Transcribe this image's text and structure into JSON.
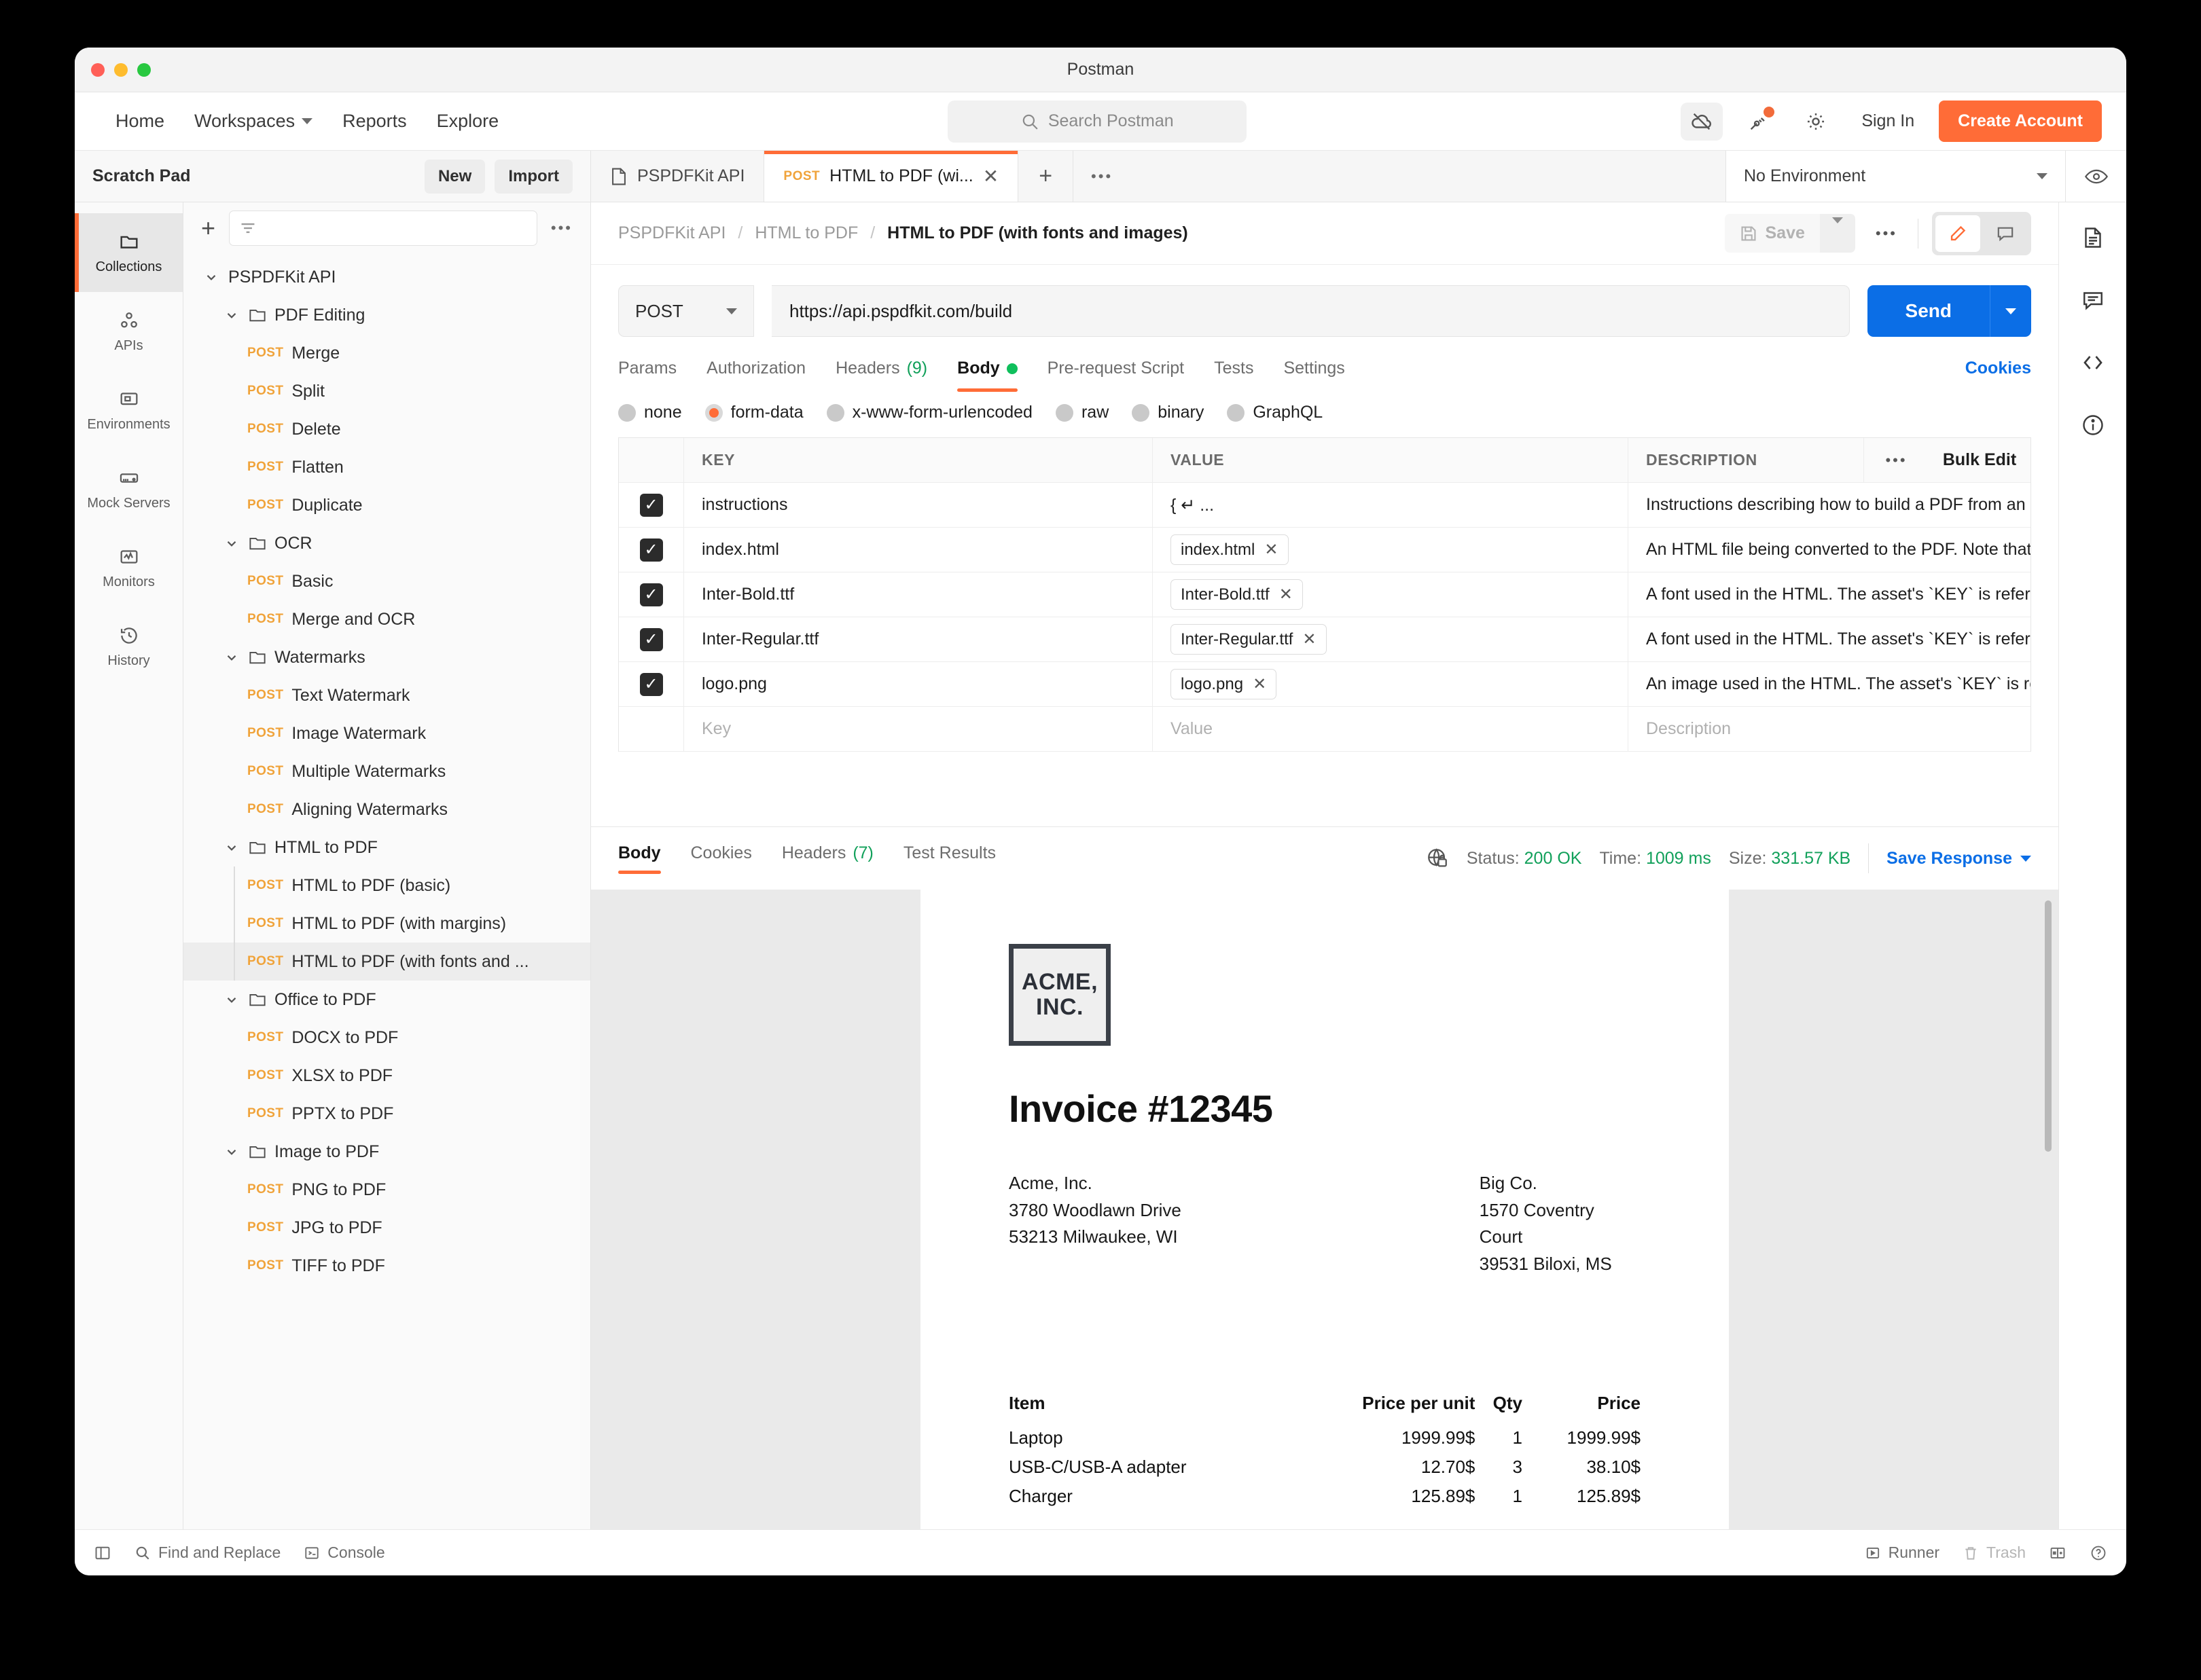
{
  "window": {
    "title": "Postman"
  },
  "topnav": {
    "items": [
      {
        "label": "Home",
        "has_caret": false
      },
      {
        "label": "Workspaces",
        "has_caret": true
      },
      {
        "label": "Reports",
        "has_caret": false
      },
      {
        "label": "Explore",
        "has_caret": false
      }
    ],
    "search_placeholder": "Search Postman",
    "sign_in": "Sign In",
    "create_account": "Create Account"
  },
  "scratchpad": {
    "title": "Scratch Pad",
    "new_label": "New",
    "import_label": "Import"
  },
  "tabs": {
    "items": [
      {
        "method": "",
        "label": "PSPDFKit API",
        "active": false
      },
      {
        "method": "POST",
        "label": "HTML to PDF (wi...",
        "active": true
      }
    ]
  },
  "environment": {
    "selected": "No Environment"
  },
  "rail": {
    "items": [
      {
        "label": "Collections",
        "icon": "collection-icon",
        "active": true
      },
      {
        "label": "APIs",
        "icon": "apis-icon",
        "active": false
      },
      {
        "label": "Environments",
        "icon": "environments-icon",
        "active": false
      },
      {
        "label": "Mock Servers",
        "icon": "mock-servers-icon",
        "active": false
      },
      {
        "label": "Monitors",
        "icon": "monitors-icon",
        "active": false
      },
      {
        "label": "History",
        "icon": "history-icon",
        "active": false
      }
    ]
  },
  "sidebar": {
    "tree": [
      {
        "depth": 0,
        "type": "collection",
        "label": "PSPDFKit API",
        "expanded": true
      },
      {
        "depth": 1,
        "type": "folder",
        "label": "PDF Editing",
        "expanded": true
      },
      {
        "depth": 2,
        "type": "request",
        "method": "POST",
        "label": "Merge"
      },
      {
        "depth": 2,
        "type": "request",
        "method": "POST",
        "label": "Split"
      },
      {
        "depth": 2,
        "type": "request",
        "method": "POST",
        "label": "Delete"
      },
      {
        "depth": 2,
        "type": "request",
        "method": "POST",
        "label": "Flatten"
      },
      {
        "depth": 2,
        "type": "request",
        "method": "POST",
        "label": "Duplicate"
      },
      {
        "depth": 1,
        "type": "folder",
        "label": "OCR",
        "expanded": true
      },
      {
        "depth": 2,
        "type": "request",
        "method": "POST",
        "label": "Basic"
      },
      {
        "depth": 2,
        "type": "request",
        "method": "POST",
        "label": "Merge and OCR"
      },
      {
        "depth": 1,
        "type": "folder",
        "label": "Watermarks",
        "expanded": true
      },
      {
        "depth": 2,
        "type": "request",
        "method": "POST",
        "label": "Text Watermark"
      },
      {
        "depth": 2,
        "type": "request",
        "method": "POST",
        "label": "Image Watermark"
      },
      {
        "depth": 2,
        "type": "request",
        "method": "POST",
        "label": "Multiple Watermarks"
      },
      {
        "depth": 2,
        "type": "request",
        "method": "POST",
        "label": "Aligning Watermarks"
      },
      {
        "depth": 1,
        "type": "folder",
        "label": "HTML to PDF",
        "expanded": true
      },
      {
        "depth": 2,
        "type": "request",
        "method": "POST",
        "label": "HTML to PDF (basic)",
        "guide": true
      },
      {
        "depth": 2,
        "type": "request",
        "method": "POST",
        "label": "HTML to PDF (with margins)",
        "guide": true
      },
      {
        "depth": 2,
        "type": "request",
        "method": "POST",
        "label": "HTML to PDF (with fonts and ...",
        "guide": true,
        "selected": true
      },
      {
        "depth": 1,
        "type": "folder",
        "label": "Office to PDF",
        "expanded": true
      },
      {
        "depth": 2,
        "type": "request",
        "method": "POST",
        "label": "DOCX to PDF"
      },
      {
        "depth": 2,
        "type": "request",
        "method": "POST",
        "label": "XLSX to PDF"
      },
      {
        "depth": 2,
        "type": "request",
        "method": "POST",
        "label": "PPTX to PDF"
      },
      {
        "depth": 1,
        "type": "folder",
        "label": "Image to PDF",
        "expanded": true
      },
      {
        "depth": 2,
        "type": "request",
        "method": "POST",
        "label": "PNG to PDF"
      },
      {
        "depth": 2,
        "type": "request",
        "method": "POST",
        "label": "JPG to PDF"
      },
      {
        "depth": 2,
        "type": "request",
        "method": "POST",
        "label": "TIFF to PDF"
      }
    ]
  },
  "request": {
    "breadcrumb": [
      "PSPDFKit API",
      "HTML to PDF",
      "HTML to PDF (with fonts and images)"
    ],
    "save_label": "Save",
    "method": "POST",
    "url": "https://api.pspdfkit.com/build",
    "send_label": "Send",
    "tabs": [
      {
        "label": "Params",
        "active": false
      },
      {
        "label": "Authorization",
        "active": false
      },
      {
        "label": "Headers",
        "count": "(9)",
        "active": false
      },
      {
        "label": "Body",
        "dot": true,
        "active": true
      },
      {
        "label": "Pre-request Script",
        "active": false
      },
      {
        "label": "Tests",
        "active": false
      },
      {
        "label": "Settings",
        "active": false
      }
    ],
    "cookies_link": "Cookies",
    "body_modes": [
      {
        "label": "none",
        "selected": false
      },
      {
        "label": "form-data",
        "selected": true
      },
      {
        "label": "x-www-form-urlencoded",
        "selected": false
      },
      {
        "label": "raw",
        "selected": false
      },
      {
        "label": "binary",
        "selected": false
      },
      {
        "label": "GraphQL",
        "selected": false
      }
    ],
    "table": {
      "headers": {
        "key": "KEY",
        "value": "VALUE",
        "description": "DESCRIPTION",
        "bulk_edit": "Bulk Edit"
      },
      "rows": [
        {
          "checked": true,
          "key": "instructions",
          "value": "{ ↵ ...",
          "value_is_chip": false,
          "description": "Instructions describing how to build a PDF from an HTML ..."
        },
        {
          "checked": true,
          "key": "index.html",
          "value": "index.html",
          "value_is_chip": true,
          "description": "An HTML file being converted to the PDF. Note that the fil..."
        },
        {
          "checked": true,
          "key": "Inter-Bold.ttf",
          "value": "Inter-Bold.ttf",
          "value_is_chip": true,
          "description": "A font used in the HTML. The asset's `KEY` is referenced ..."
        },
        {
          "checked": true,
          "key": "Inter-Regular.ttf",
          "value": "Inter-Regular.ttf",
          "value_is_chip": true,
          "description": "A font used in the HTML. The asset's `KEY` is referenced ..."
        },
        {
          "checked": true,
          "key": "logo.png",
          "value": "logo.png",
          "value_is_chip": true,
          "description": "An image used in the HTML. The asset's `KEY` is referenc..."
        }
      ],
      "empty_row": {
        "key": "Key",
        "value": "Value",
        "description": "Description"
      }
    }
  },
  "response": {
    "tabs": [
      {
        "label": "Body",
        "active": true
      },
      {
        "label": "Cookies",
        "active": false
      },
      {
        "label": "Headers",
        "count": "(7)",
        "active": false
      },
      {
        "label": "Test Results",
        "active": false
      }
    ],
    "status_label": "Status:",
    "status_value": "200 OK",
    "time_label": "Time:",
    "time_value": "1009 ms",
    "size_label": "Size:",
    "size_value": "331.57 KB",
    "save_response": "Save Response"
  },
  "pdf_preview": {
    "logo_line1": "ACME,",
    "logo_line2": "INC.",
    "title": "Invoice #12345",
    "from": [
      "Acme, Inc.",
      "3780 Woodlawn Drive",
      "53213 Milwaukee, WI"
    ],
    "to": [
      "Big Co.",
      "1570 Coventry Court",
      "39531 Biloxi, MS"
    ],
    "table": {
      "headers": [
        "Item",
        "Price per unit",
        "Qty",
        "Price"
      ],
      "rows": [
        [
          "Laptop",
          "1999.99$",
          "1",
          "1999.99$"
        ],
        [
          "USB-C/USB-A adapter",
          "12.70$",
          "3",
          "38.10$"
        ],
        [
          "Charger",
          "125.89$",
          "1",
          "125.89$"
        ]
      ]
    }
  },
  "footer": {
    "find_replace": "Find and Replace",
    "console": "Console",
    "runner": "Runner",
    "trash": "Trash"
  },
  "colors": {
    "accent_orange": "#ff6c37",
    "send_blue": "#0b6ee6",
    "status_green": "#11a05a",
    "method_post": "#f0a33a"
  }
}
